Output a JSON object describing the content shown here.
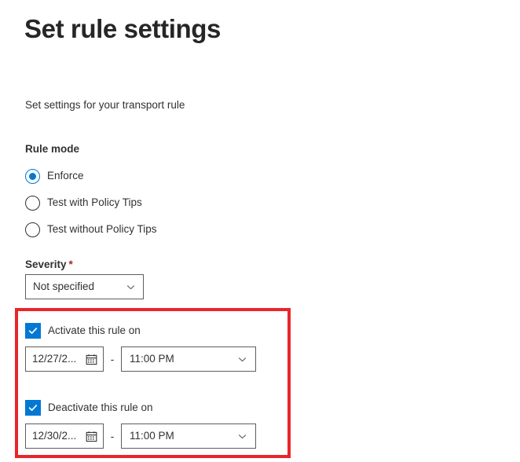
{
  "page": {
    "title": "Set rule settings",
    "subtitle": "Set settings for your transport rule"
  },
  "rule_mode": {
    "label": "Rule mode",
    "options": [
      {
        "label": "Enforce",
        "selected": true
      },
      {
        "label": "Test with Policy Tips",
        "selected": false
      },
      {
        "label": "Test without Policy Tips",
        "selected": false
      }
    ]
  },
  "severity": {
    "label": "Severity",
    "required_marker": "*",
    "value": "Not specified",
    "chevron_icon": "chevron-down-icon"
  },
  "activate": {
    "checkbox_label": "Activate this rule on",
    "checked": true,
    "checkbox_icon": "checkmark-icon",
    "date_value": "12/27/2...",
    "date_icon": "calendar-icon",
    "separator": "-",
    "time_value": "11:00 PM",
    "time_chevron_icon": "chevron-down-icon"
  },
  "deactivate": {
    "checkbox_label": "Deactivate this rule on",
    "checked": true,
    "checkbox_icon": "checkmark-icon",
    "date_value": "12/30/2...",
    "date_icon": "calendar-icon",
    "separator": "-",
    "time_value": "11:00 PM",
    "time_chevron_icon": "chevron-down-icon"
  },
  "highlight": {
    "color": "#e8262a",
    "description": "red-annotation-box"
  },
  "colors": {
    "accent": "#0078d4",
    "text": "#323130",
    "title": "#262626",
    "required": "#a4262c",
    "border": "#605e5c",
    "highlight": "#e8262a"
  }
}
